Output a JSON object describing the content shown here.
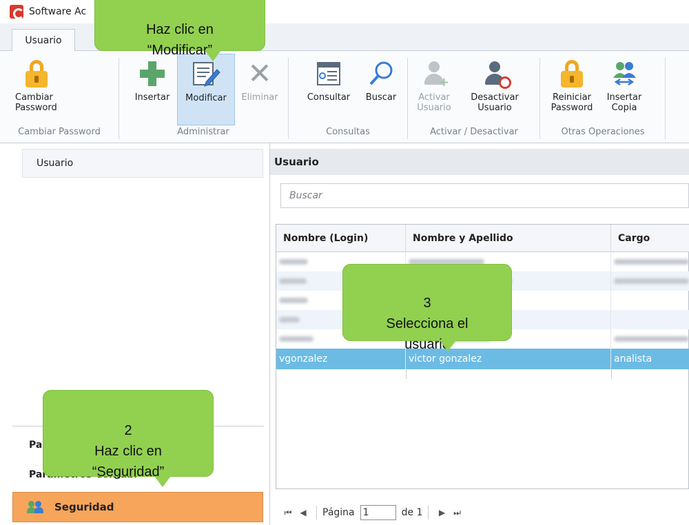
{
  "window": {
    "title": "Software Ac"
  },
  "ribbon": {
    "tab": "Usuario",
    "buttons": {
      "cambiar_password": "Cambiar\nPassword",
      "insertar": "Insertar",
      "modificar": "Modificar",
      "eliminar": "Eliminar",
      "consultar": "Consultar",
      "buscar": "Buscar",
      "activar_usuario": "Activar\nUsuario",
      "desactivar_usuario": "Desactivar\nUsuario",
      "reiniciar_password": "Reiniciar\nPassword",
      "insertar_copia": "Insertar\nCopia"
    },
    "groups": {
      "cambiar_password": "Cambiar Password",
      "administrar": "Administrar",
      "consultas": "Consultas",
      "activar_desactivar": "Activar / Desactivar",
      "otras_operaciones": "Otras Operaciones"
    }
  },
  "sidebar": {
    "item": "Usuario",
    "groups": [
      "Pa",
      "Parametros Contabi"
    ],
    "active": "Seguridad"
  },
  "main": {
    "header": "Usuario",
    "search_placeholder": "Buscar",
    "columns": [
      "Nombre (Login)",
      "Nombre y Apellido",
      "Cargo"
    ],
    "selected_row": {
      "login": "vgonzalez",
      "nombre": "victor gonzalez",
      "cargo": "analista"
    }
  },
  "pager": {
    "label": "Página",
    "page": "1",
    "of": "de 1"
  },
  "callouts": {
    "modificar": "Haz clic en\n“Modificar”",
    "seguridad": "2\nHaz clic en\n“Seguridad”",
    "seleccionar": "3\nSelecciona el\nusuario"
  },
  "colors": {
    "callout": "#92d050",
    "active_nav": "#f7a55b",
    "selected_row": "#6cbbe4"
  }
}
